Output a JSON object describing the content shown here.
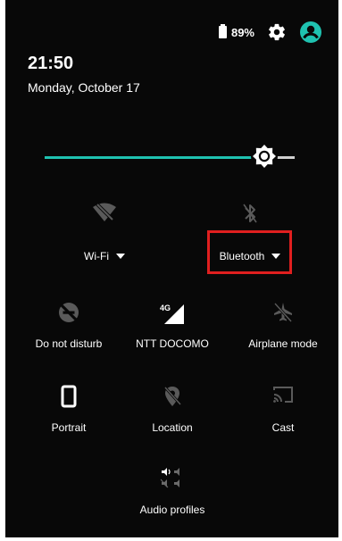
{
  "status": {
    "battery_text": "89%"
  },
  "clock": {
    "time": "21:50",
    "date": "Monday, October 17"
  },
  "brightness": {
    "level": 0.88
  },
  "tiles": {
    "wifi": "Wi-Fi",
    "bluetooth": "Bluetooth",
    "dnd": "Do not disturb",
    "mobile": "NTT DOCOMO",
    "mobile_badge": "4G",
    "airplane": "Airplane mode",
    "rotation": "Portrait",
    "location": "Location",
    "cast": "Cast",
    "audio": "Audio profiles"
  },
  "colors": {
    "panel_bg": "#080808",
    "accent": "#1fc2b0",
    "dim_icon": "#5a5a5a",
    "highlight": "#e01f1f"
  },
  "icons": {
    "battery": "battery-icon",
    "settings": "gear-icon",
    "user": "account-icon",
    "brightness": "brightness-icon",
    "wifi": "wifi-off-icon",
    "bluetooth": "bluetooth-icon",
    "dnd": "do-not-disturb-icon",
    "mobile": "signal-icon",
    "airplane": "airplane-icon",
    "rotation": "portrait-icon",
    "location": "location-off-icon",
    "cast": "cast-icon",
    "audio": "audio-profiles-icon"
  }
}
